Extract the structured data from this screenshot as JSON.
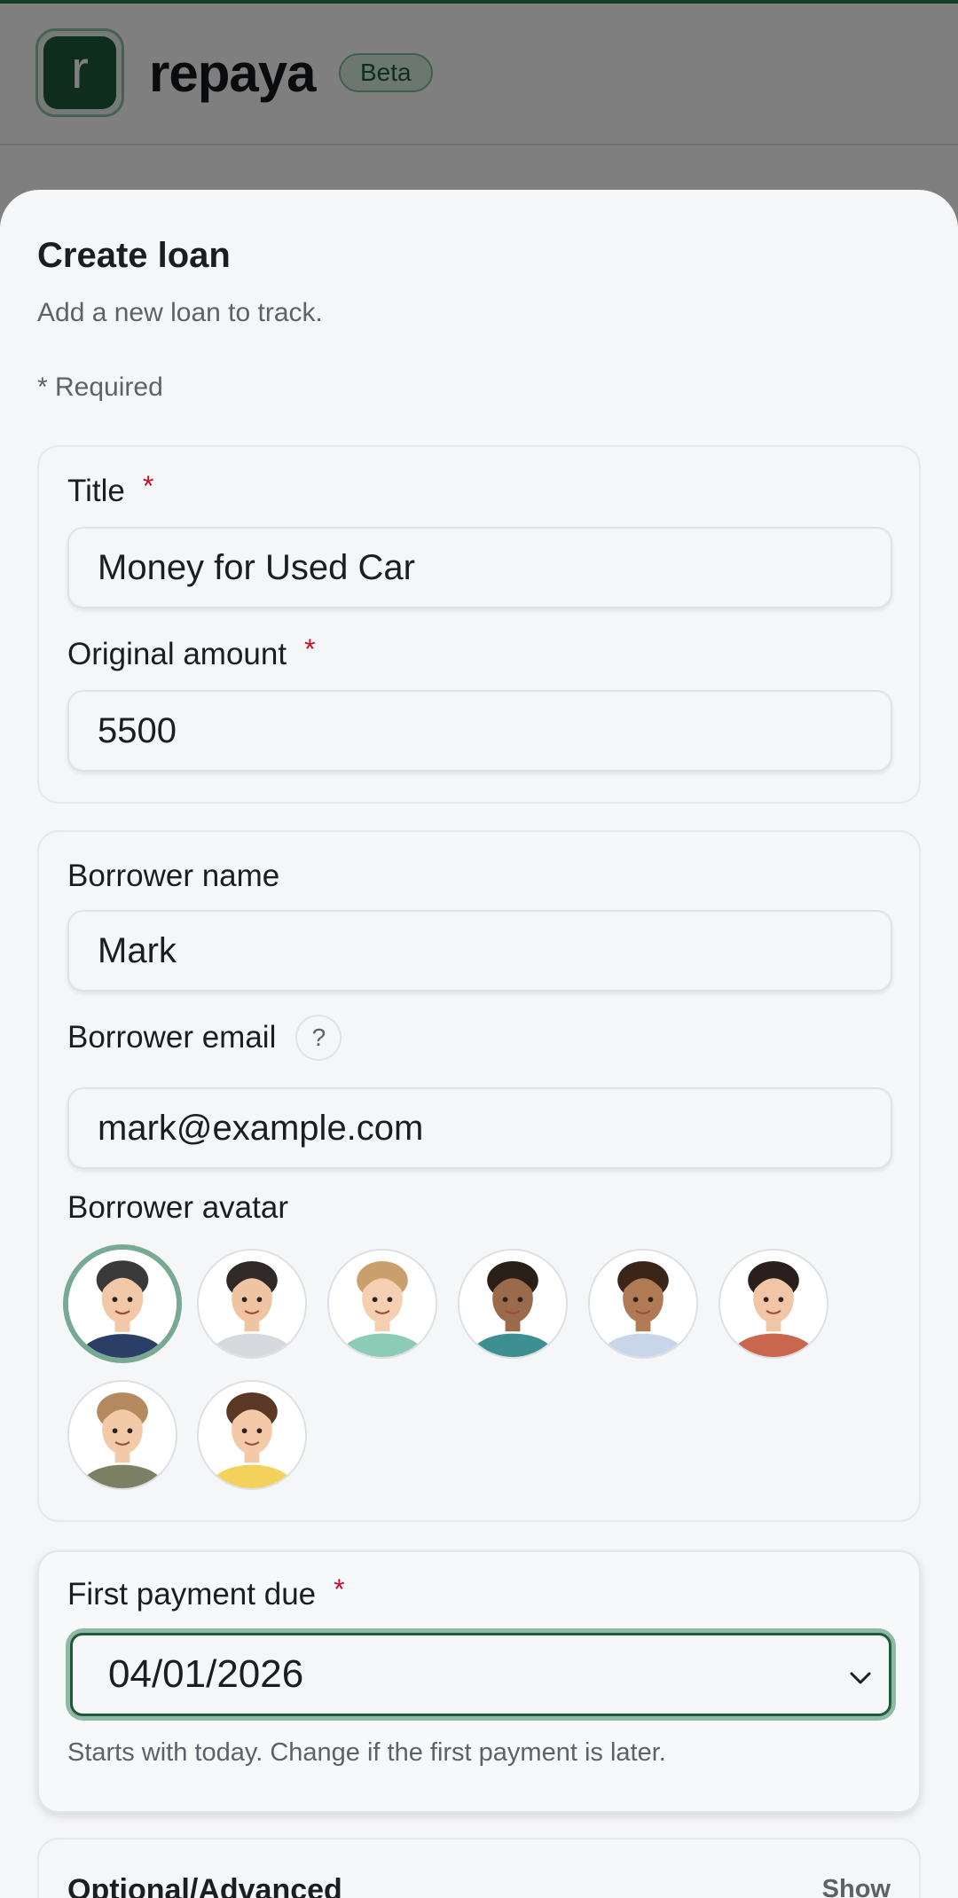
{
  "app": {
    "logo_letter": "r",
    "brand": "repaya",
    "badge": "Beta"
  },
  "sheet": {
    "title": "Create loan",
    "subtitle": "Add a new loan to track.",
    "required_note": "* Required"
  },
  "loan": {
    "title_label": "Title",
    "title_value": "Money for Used Car",
    "amount_label": "Original amount",
    "amount_value": "5500",
    "required_mark": "*"
  },
  "borrower": {
    "name_label": "Borrower name",
    "name_value": "Mark",
    "email_label": "Borrower email",
    "email_help": "?",
    "email_value": "mark@example.com",
    "avatar_label": "Borrower avatar",
    "avatars": [
      {
        "name": "man-navy-shirt",
        "selected": true,
        "skin": "#f1c8a8",
        "hair": "#3b3a3a",
        "shirt": "#2b3f66"
      },
      {
        "name": "man-beard-gray-shirt",
        "selected": false,
        "skin": "#efc4a3",
        "hair": "#2f2a27",
        "shirt": "#d5d9de"
      },
      {
        "name": "woman-blonde",
        "selected": false,
        "skin": "#f4cfb0",
        "hair": "#c9a06b",
        "shirt": "#8ccbb6"
      },
      {
        "name": "man-teal-shirt",
        "selected": false,
        "skin": "#9a6a4a",
        "hair": "#2a1e18",
        "shirt": "#3e8f91"
      },
      {
        "name": "woman-curly",
        "selected": false,
        "skin": "#b07a55",
        "hair": "#3a2518",
        "shirt": "#c9d6ea"
      },
      {
        "name": "woman-dark-hair",
        "selected": false,
        "skin": "#f0c6a6",
        "hair": "#2a1f1c",
        "shirt": "#c8674e"
      },
      {
        "name": "boy-olive-shirt",
        "selected": false,
        "skin": "#f2caa8",
        "hair": "#b48a5e",
        "shirt": "#7b7f63"
      },
      {
        "name": "girl-yellow-shirt",
        "selected": false,
        "skin": "#f3c9a8",
        "hair": "#5a3825",
        "shirt": "#f2d25a"
      }
    ]
  },
  "payment": {
    "label": "First payment due",
    "value": "04/01/2026",
    "hint": "Starts with today. Change if the first payment is later."
  },
  "optional": {
    "title": "Optional/Advanced",
    "toggle": "Show"
  }
}
